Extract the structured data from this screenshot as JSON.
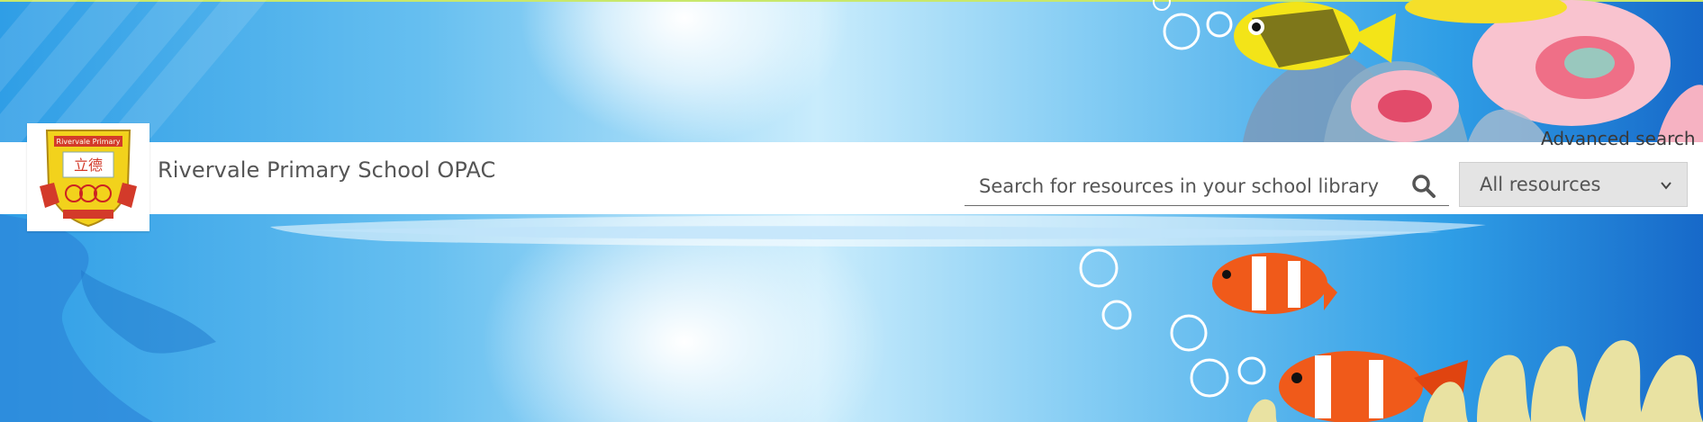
{
  "site": {
    "title": "Rivervale Primary School OPAC",
    "logo_banner_text": "Rivervale Primary",
    "logo_chinese": "立德"
  },
  "header": {
    "advanced_search_label": "Advanced search"
  },
  "search": {
    "placeholder": "Search for resources in your school library",
    "value": "",
    "icon": "search-icon"
  },
  "resource_filter": {
    "selected": "All resources",
    "icon": "chevron-down-icon"
  },
  "colors": {
    "header_bg": "#ffffff",
    "title_text": "#555555",
    "select_bg": "#e4e4e4",
    "ocean_blue": "#2f9ee6"
  }
}
